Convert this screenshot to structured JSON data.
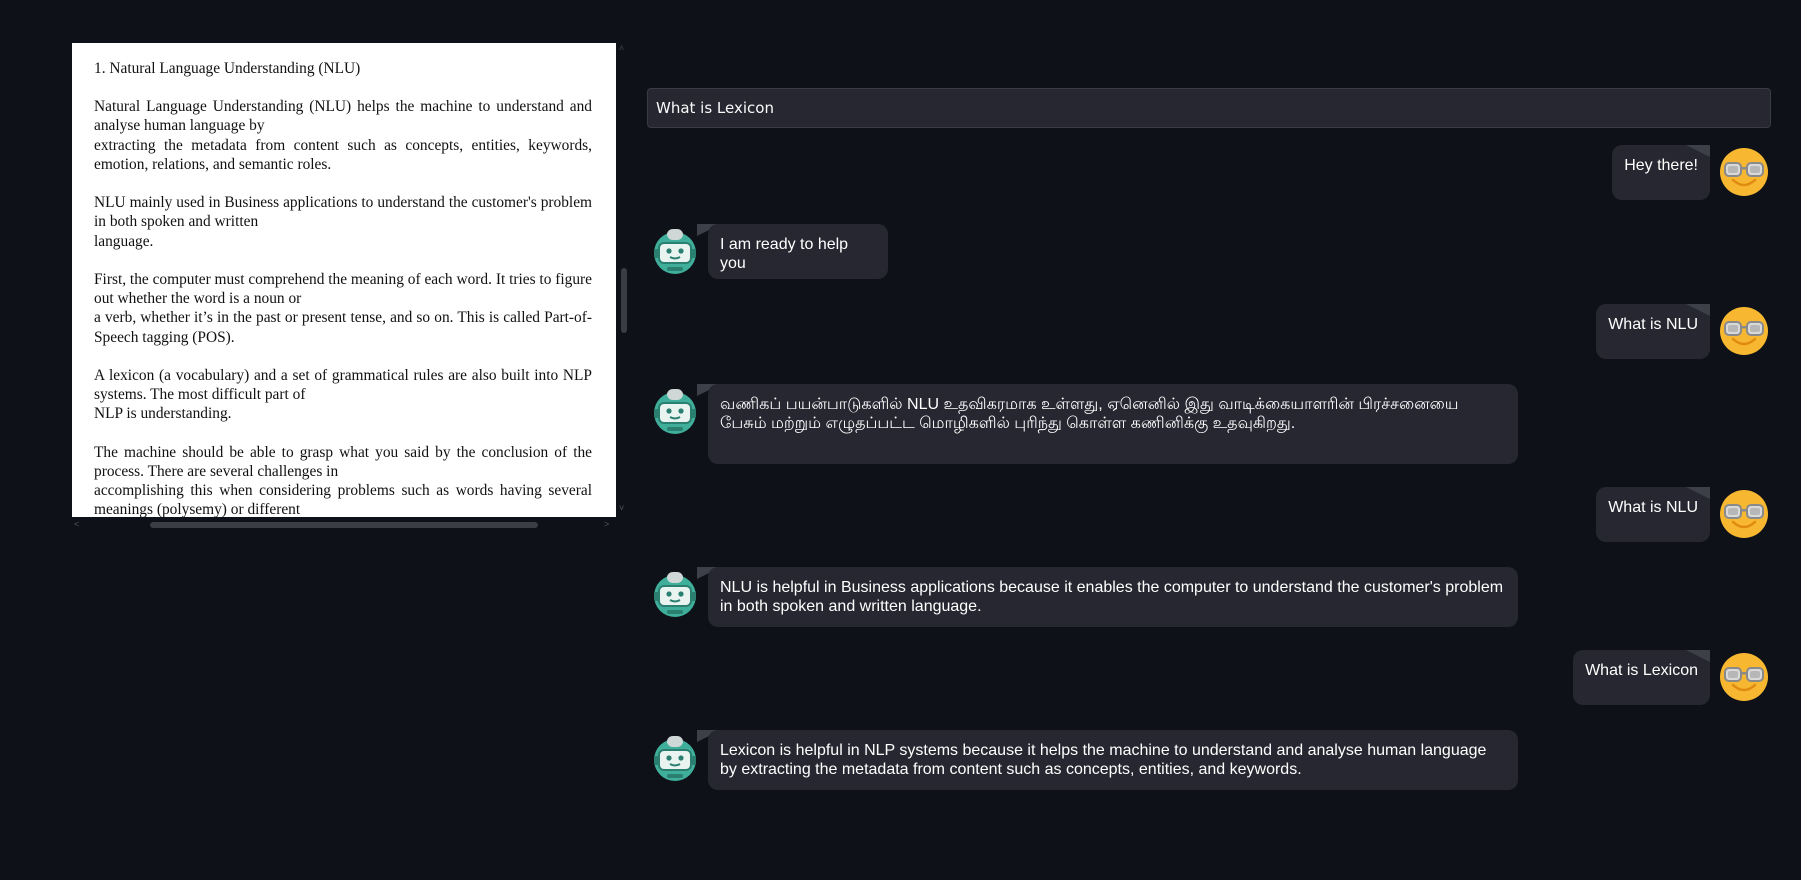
{
  "document": {
    "heading": "1. Natural Language Understanding (NLU)",
    "paragraphs": [
      [
        "Natural Language Understanding (NLU) helps the machine to understand and analyse human language by",
        "extracting the metadata from content such as concepts, entities, keywords, emotion, relations, and semantic roles."
      ],
      [
        "NLU mainly used in Business applications to understand the customer's problem in both spoken and written",
        "language."
      ],
      [
        "First, the computer must comprehend the meaning of each word. It tries to figure out whether the word is a noun or",
        "a verb, whether it’s in the past or present tense, and so on. This is called Part-of-Speech tagging (POS)."
      ],
      [
        "A lexicon (a vocabulary) and a set of grammatical rules are also built into NLP systems. The most difficult part of",
        "NLP is understanding."
      ],
      [
        "The machine should be able to grasp what you said by the conclusion of the process. There are several challenges in",
        "accomplishing this when considering problems such as words having several meanings (polysemy) or different"
      ]
    ]
  },
  "chat": {
    "input_value": "What is Lexicon",
    "messages": [
      {
        "role": "user",
        "text": "Hey there!"
      },
      {
        "role": "bot",
        "text": "I am ready to help you"
      },
      {
        "role": "user",
        "text": "What is NLU"
      },
      {
        "role": "bot",
        "text": "வணிகப் பயன்பாடுகளில் NLU உதவிகரமாக உள்ளது, ஏனெனில் இது வாடிக்கையாளரின் பிரச்சனையை பேசும் மற்றும் எழுதப்பட்ட மொழிகளில் புரிந்து கொள்ள கணினிக்கு உதவுகிறது."
      },
      {
        "role": "user",
        "text": "What is NLU"
      },
      {
        "role": "bot",
        "text": "NLU is helpful in Business applications because it enables the computer to understand the customer's problem in both spoken and written language."
      },
      {
        "role": "user",
        "text": "What is Lexicon"
      },
      {
        "role": "bot",
        "text": "Lexicon is helpful in NLP systems because it helps the machine to understand and analyse human language by extracting the metadata from content such as concepts, entities, and keywords."
      }
    ]
  },
  "colors": {
    "background": "#0e1117",
    "bubble": "#262730",
    "user_avatar": "#f7b731",
    "bot_avatar": "#3fae9a"
  },
  "icons": {
    "user_avatar": "sunglasses-face-icon",
    "bot_avatar": "robot-face-icon"
  }
}
